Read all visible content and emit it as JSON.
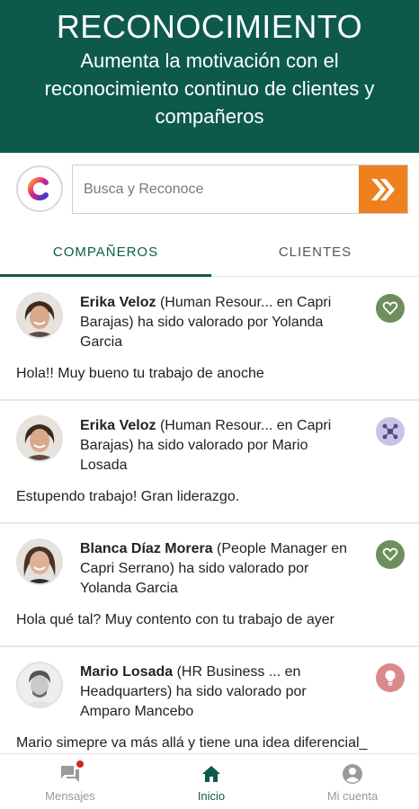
{
  "header": {
    "title": "RECONOCIMIENTO",
    "subtitle": "Aumenta la motivación con el reconocimiento continuo de clientes y compañeros"
  },
  "search": {
    "placeholder": "Busca y Reconoce",
    "button_icon": "double-chevron-right-icon",
    "logo_icon": "app-logo-c-icon"
  },
  "tabs": [
    {
      "label": "COMPAÑEROS",
      "active": true
    },
    {
      "label": "CLIENTES",
      "active": false
    }
  ],
  "feed": [
    {
      "name": "Erika Veloz",
      "details": " (Human Resour... en Capri Barajas) ha sido valorado por Yolanda Garcia",
      "message": "Hola!! Muy bueno tu trabajo de anoche",
      "badge_icon": "heart-icon",
      "badge_color": "#6e8e5e"
    },
    {
      "name": "Erika Veloz",
      "details": " (Human Resour... en Capri Barajas) ha sido valorado por Mario Losada",
      "message": "Estupendo trabajo! Gran liderazgo.",
      "badge_icon": "network-icon",
      "badge_color": "#c9c4e4"
    },
    {
      "name": "Blanca Díaz Morera",
      "details": " (People Manager en Capri Serrano) ha sido valorado por Yolanda Garcia",
      "message": "Hola qué tal? Muy contento con tu trabajo de ayer",
      "badge_icon": "heart-icon",
      "badge_color": "#6e8e5e"
    },
    {
      "name": "Mario Losada",
      "details": " (HR Business ... en Headquarters) ha sido valorado por Amparo Mancebo",
      "message": "Mario simepre va más allá y tiene una idea diferencial_",
      "badge_icon": "lightbulb-icon",
      "badge_color": "#d98b8b"
    }
  ],
  "bottom_nav": [
    {
      "label": "Mensajes",
      "icon": "messages-icon",
      "active": false,
      "has_notification": true
    },
    {
      "label": "Inicio",
      "icon": "home-icon",
      "active": true
    },
    {
      "label": "Mi cuenta",
      "icon": "account-icon",
      "active": false
    }
  ],
  "colors": {
    "brand_green": "#0d5a4d",
    "accent_orange": "#f07f1d",
    "notification_red": "#d32525"
  }
}
